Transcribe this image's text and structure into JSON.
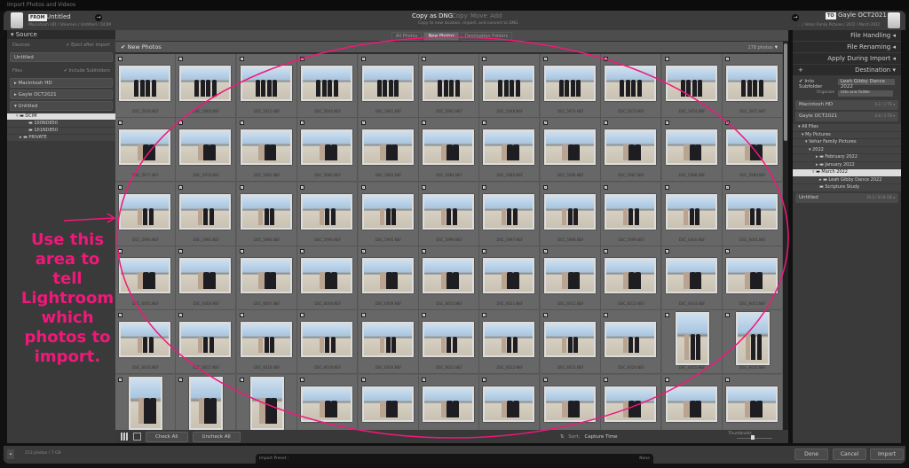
{
  "window": {
    "title": "Import Photos and Videos"
  },
  "header": {
    "from_tag": "FROM",
    "source_name": "Untitled",
    "source_path": "Macintosh HD / Volumes / Untitled / DCIM",
    "modes": [
      "Copy as DNG",
      "Copy",
      "Move",
      "Add"
    ],
    "active_mode": "Copy as DNG",
    "mode_desc": "Copy to new location, import, and convert to DNG",
    "to_tag": "TO",
    "dest_name": "Gayle OCT2021",
    "dest_path": "... / Vehar Family Pictures / 2022 / March 2022"
  },
  "source": {
    "title": "Source",
    "devices_label": "Devices",
    "eject_label": "Eject after import",
    "device": "Untitled",
    "files_label": "Files",
    "include_sub_label": "Include Subfolders",
    "volumes": [
      "Macintosh HD",
      "Gayle OCT2021",
      "Untitled"
    ],
    "tree": [
      {
        "label": "DCIM",
        "sel": true
      },
      {
        "label": "100ND850"
      },
      {
        "label": "101ND850"
      },
      {
        "label": "PRIVATE"
      }
    ]
  },
  "tabs": [
    "All Photos",
    "New Photos",
    "Destination Folders"
  ],
  "active_tab": "New Photos",
  "grid": {
    "title": "New Photos",
    "count": "278 photos",
    "rows": [
      [
        "DSC_5958.NEF",
        "DSC_5960.NEF",
        "DSC_5013.NEF",
        "DSC_5944.NEF",
        "DSC_5961.NEF",
        "DSC_5962.NEF",
        "DSC_5048.NEF",
        "DSC_5970.NEF",
        "DSC_5973.NEF",
        "DSC_5974.NEF",
        "DSC_5975.NEF"
      ],
      [
        "DSC_5977.NEF",
        "DSC_5978.NEF",
        "DSC_5981.NEF",
        "DSC_5982.NEF",
        "DSC_5983.NEF",
        "DSC_5984.NEF",
        "DSC_5985.NEF",
        "DSC_5986.NEF",
        "DSC_5987.NEF",
        "DSC_5988.NEF",
        "DSC_5989.NEF"
      ],
      [
        "DSC_5990.NEF",
        "DSC_5991.NEF",
        "DSC_5993.NEF",
        "DSC_5994.NEF",
        "DSC_5995.NEF",
        "DSC_5996.NEF",
        "DSC_5997.NEF",
        "DSC_5998.NEF",
        "DSC_5999.NEF",
        "DSC_6000.NEF",
        "DSC_6001.NEF"
      ],
      [
        "DSC_6005.NEF",
        "DSC_6006.NEF",
        "DSC_6007.NEF",
        "DSC_6008.NEF",
        "DSC_6009.NEF",
        "DSC_6010.NEF",
        "DSC_6011.NEF",
        "DSC_6012.NEF",
        "DSC_6013.NEF",
        "DSC_6014.NEF",
        "DSC_6015.NEF"
      ],
      [
        "DSC_6016.NEF",
        "DSC_6017.NEF",
        "DSC_6018.NEF",
        "DSC_6019.NEF",
        "DSC_6020.NEF",
        "DSC_6021.NEF",
        "DSC_6022.NEF",
        "DSC_6023.NEF",
        "DSC_6024.NEF",
        "DSC_6025.NEF",
        "DSC_6026.NEF"
      ],
      [
        "DSC_6027.NEF",
        "DSC_6028.NEF",
        "DSC_6029.NEF",
        "DSC_6030.NEF",
        "DSC_6031.NEF",
        "DSC_6032.NEF",
        "DSC_6033.NEF",
        "DSC_6034.NEF",
        "DSC_6035.NEF",
        "DSC_6036.NEF",
        "DSC_6037.NEF"
      ]
    ]
  },
  "toolbar": {
    "check_all": "Check All",
    "uncheck_all": "Uncheck All",
    "sort_label": "Sort:",
    "sort_value": "Capture Time",
    "thumbnails_label": "Thumbnails",
    "thumbnail_size": 0.45
  },
  "right": {
    "sections": [
      "File Handling",
      "File Renaming",
      "Apply During Import"
    ],
    "destination": "Destination",
    "into_subfolder": "Into Subfolder",
    "subfolder_name": "Leah Gibby Dance 2022",
    "organize_label": "Organize",
    "organize_value": "Into one folder",
    "volumes": [
      {
        "name": "Macintosh HD",
        "space": "0.2 / 1 TB"
      },
      {
        "name": "Gayle OCT2021",
        "space": "0.8 / 5 TB"
      }
    ],
    "tree": [
      "All Files",
      "My Pictures",
      "Vehar Family Pictures",
      "2022",
      "February 2022",
      "January 2022",
      "March 2022",
      "Leah Gibby Dance 2022",
      "Scripture Study"
    ],
    "selected_folder": "March 2022",
    "last_volume": {
      "name": "Untitled",
      "space": "19.3 / 63.8 GB"
    }
  },
  "bottom": {
    "summary": "253 photos / 7 GB",
    "preset_label": "Import Preset :",
    "preset_value": "None",
    "done": "Done",
    "cancel": "Cancel",
    "import": "Import"
  },
  "annotation": {
    "text": "Use this area to tell Lightroom which photos to import.",
    "color": "#f0187a"
  }
}
